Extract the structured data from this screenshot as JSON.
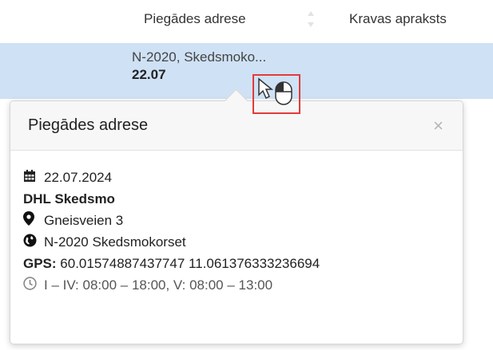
{
  "columns": {
    "delivery_address": "Piegādes adrese",
    "cargo_description": "Kravas apraksts"
  },
  "row": {
    "address_short": "N-2020, Skedsmoko...",
    "date_short": "22.07"
  },
  "popover": {
    "title": "Piegādes adrese",
    "close": "×",
    "date": "22.07.2024",
    "company": "DHL Skedsmo",
    "street": "Gneisveien 3",
    "postal": "N-2020 Skedsmokorset",
    "gps_label": "GPS:",
    "gps_value": "60.01574887437747 11.061376333236694",
    "hours": "I – IV: 08:00 – 18:00, V: 08:00 – 13:00"
  },
  "icons": {
    "date": "calendar-icon",
    "street": "map-marker-icon",
    "postal": "globe-icon",
    "hours": "clock-icon",
    "close": "close-icon",
    "sort": "sort-icon"
  },
  "colors": {
    "row_highlight": "#cfe1f5",
    "cursor_highlight": "#e23b3b"
  }
}
